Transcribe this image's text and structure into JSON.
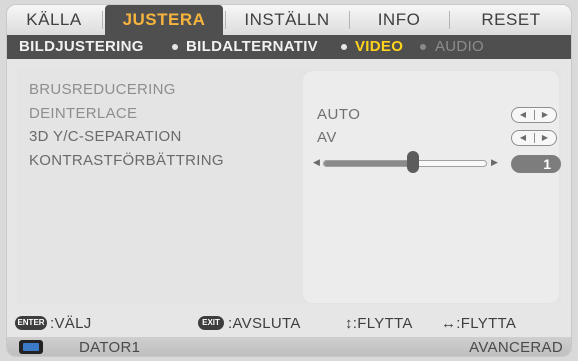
{
  "tabs": [
    {
      "label": "KÄLLA"
    },
    {
      "label": "JUSTERA"
    },
    {
      "label": "INSTÄLLN"
    },
    {
      "label": "INFO"
    },
    {
      "label": "RESET"
    }
  ],
  "subtabs": [
    {
      "label": "BILDJUSTERING"
    },
    {
      "label": "BILDALTERNATIV"
    },
    {
      "label": "VIDEO"
    },
    {
      "label": "AUDIO"
    }
  ],
  "settings": {
    "noise_reduction_label": "BRUSREDUCERING",
    "deinterlace_label": "DEINTERLACE",
    "deinterlace_value": "AUTO",
    "yc_separation_label": "3D Y/C-SEPARATION",
    "yc_separation_value": "AV",
    "contrast_label": "KONTRASTFÖRBÄTTRING",
    "contrast_value": "1",
    "contrast_level_fraction": 0.55
  },
  "help": {
    "enter_key": "ENTER",
    "select_text": ":VÄLJ",
    "exit_key": "EXIT",
    "exit_text": ":AVSLUTA",
    "move_v_text": "↕:FLYTTA",
    "move_h_text": "↔:FLYTTA"
  },
  "status": {
    "source": "DATOR1",
    "mode": "AVANCERAD"
  },
  "colors": {
    "active_tab": "#f6b43d",
    "active_subtab": "#ffd21c",
    "bar": "#4f4f4f"
  }
}
